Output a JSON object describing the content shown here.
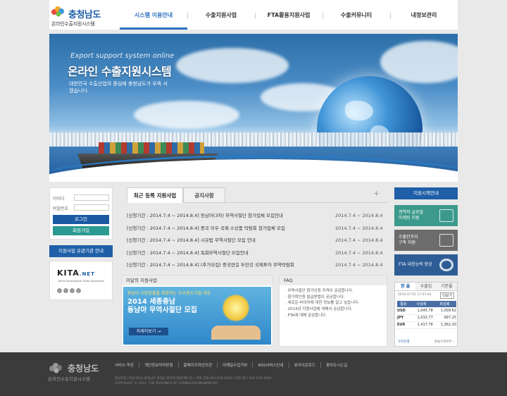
{
  "brand": {
    "name": "충청남도",
    "subtitle": "온라인수출지원시스템"
  },
  "gnb": [
    "시스템 이용안내",
    "수출지원사업",
    "FTA활용지원사업",
    "수출커뮤니티",
    "내정보관리"
  ],
  "hero": {
    "en": "Export support system online",
    "title": "온라인 수출지원시스템",
    "desc": "대한민국 수출산업의 중심에 충청남도가 우뚝 서겠습니다."
  },
  "login": {
    "id_label": "아이디",
    "pw_label": "비밀번호",
    "login": "로그인",
    "join": "회원가입"
  },
  "left_bar": "지원사업 유관기관 안내",
  "kita": {
    "logo": "KITA",
    "logo_suffix": ".NET",
    "text": "Korea International Trade Association"
  },
  "tabs": {
    "t1": "최근 등록 지원사업",
    "t2": "공지사항",
    "more": "+"
  },
  "notices": [
    {
      "title": "[신청기간 : 2014.7.4 ~ 2014.8.4] 동남아(3차) 무역사절단 참가업체 모집안내",
      "date": "2014.7.4 ~ 2014.8.4"
    },
    {
      "title": "[신청기간 : 2014.7.4 ~ 2014.8.4] 중국 이우 국제 소상품 박람회 참가업체 모집",
      "date": "2014.7.4 ~ 2014.8.4"
    },
    {
      "title": "[신청기간 : 2014.7.4 ~ 2014.8.4] 시유럽 무역사절단 모집 안내",
      "date": "2014.7.4 ~ 2014.8.4"
    },
    {
      "title": "[신청기간 : 2014.7.4 ~ 2014.8.4] 독화무역사절단 모집안내",
      "date": "2014.7.4 ~ 2014.8.4"
    },
    {
      "title": "[신청기간 : 2014.7.4 ~ 2014.8.4] (추가모집) 중국연길 두만강 국제투자 무역박람회",
      "date": "2014.7.4 ~ 2014.8.4"
    }
  ],
  "monthly": {
    "header": "이달의 지원사업",
    "tag": "동남아 시장진출을 희망하는 우수중소기업 대상",
    "line1": "2014 세종충남",
    "line2": "동남아 무역사절단 모집",
    "button": "자세히보기 →"
  },
  "faq": {
    "header": "FAQ",
    "items": [
      "· 무역사절단 참가신청 자격이 궁금합니다.",
      "· 참가확인증 발급방법이 궁금합니다.",
      "· 새로운 바이어에 대한 정보를 알고 싶습니다.",
      "· 2014년 지원사업에 대해서 궁금합니다.",
      "· FTA에 대해 궁금합니다."
    ]
  },
  "right": {
    "top": "지원시책안내",
    "box1": [
      "권역적 글로벌",
      "마케팅 지원"
    ],
    "box2": [
      "수출인프라",
      "구축 지원"
    ],
    "box3": [
      "FTA 대응능력 향상"
    ]
  },
  "fx": {
    "tabs": [
      "환 율",
      "수출입",
      "기준율"
    ],
    "date": "2014.07.01 17:07:44",
    "more": "더보기",
    "headers": [
      "통화",
      "사실때",
      "파실때"
    ],
    "rows": [
      [
        "USD",
        "1,045.78",
        "1,009.62"
      ],
      [
        "JPY",
        "1,032.77",
        "997.25"
      ],
      [
        "EUR",
        "1,417.76",
        "1,362.20"
      ]
    ],
    "bank": "우리은행",
    "note": "환율우대쿠폰 ›"
  },
  "footer": {
    "logo": "충청남도",
    "sub": "온라인수출지원시스템",
    "links": [
      "서비스 약관",
      "개인정보처리방침",
      "홈페이지개선의견",
      "이메일수집거부",
      "RSS서비스안내",
      "뷰어다운로드",
      "찾아오시는길"
    ],
    "addr": "충남도청 (350-831) 충청남도 홍성군 홍북면 충남대로 21 / 대표 전화 041-635-2000 / 대표 팩스 041-635-3000",
    "copy": "COPYRIGHT © 2014. THE PROVINCE OF CHUNGCHEONGNAM-DO."
  }
}
